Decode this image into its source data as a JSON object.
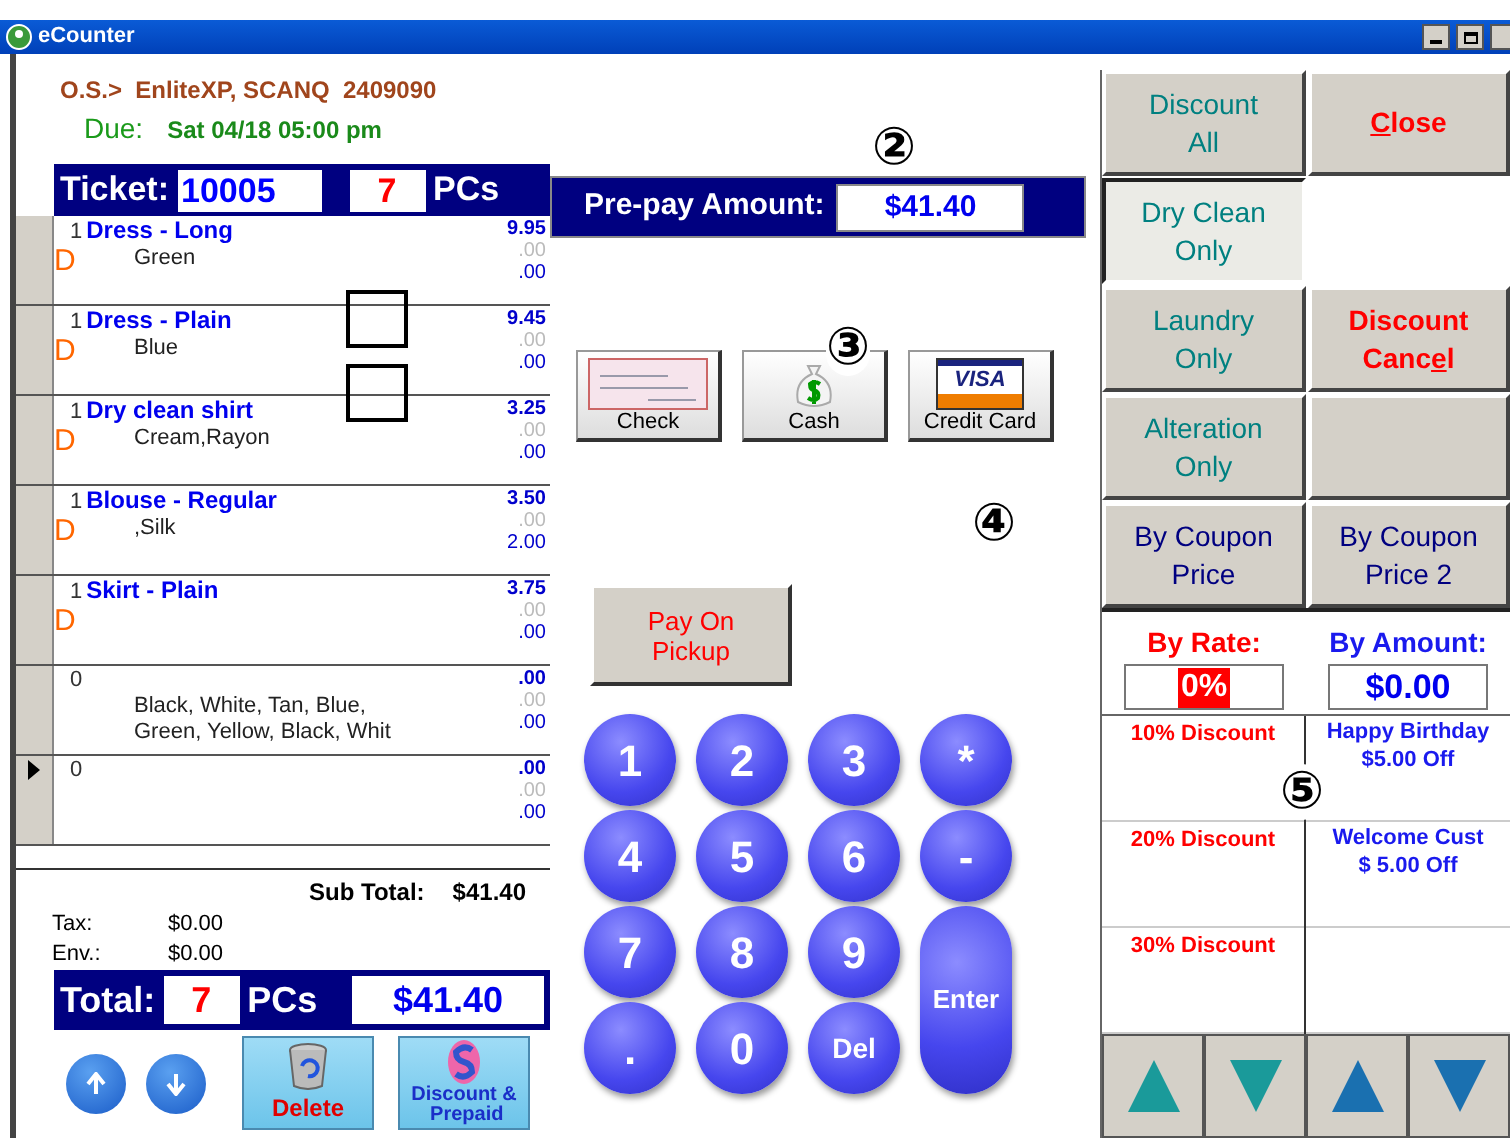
{
  "window": {
    "title": "eCounter"
  },
  "order": {
    "line": "O.S.>  EnliteXP, SCANQ  2409090",
    "due_label": "Due:",
    "due_value": "Sat 04/18 05:00 pm"
  },
  "ticket": {
    "label": "Ticket:",
    "number": "10005",
    "pieces": "7",
    "pieces_label": "PCs"
  },
  "items": [
    {
      "qty": "1",
      "name": "Dress - Long",
      "description": "Green",
      "price": "9.95",
      "line_2": ".00",
      "line_3": ".00",
      "mark": "D",
      "selected": false
    },
    {
      "qty": "1",
      "name": "Dress - Plain",
      "description": "Blue",
      "price": "9.45",
      "line_2": ".00",
      "line_3": ".00",
      "mark": "D",
      "selected": false
    },
    {
      "qty": "1",
      "name": "Dry clean shirt",
      "description": "Cream,Rayon",
      "price": "3.25",
      "line_2": ".00",
      "line_3": ".00",
      "mark": "D",
      "selected": false
    },
    {
      "qty": "1",
      "name": "Blouse - Regular",
      "description": ",Silk",
      "price": "3.50",
      "line_2": ".00",
      "line_3": "2.00",
      "mark": "D",
      "selected": false
    },
    {
      "qty": "1",
      "name": "Skirt - Plain",
      "price": "3.75",
      "line_2": ".00",
      "line_3": ".00",
      "mark": "D",
      "selected": false
    },
    {
      "qty": "0",
      "description": "Black, White, Tan, Blue,\nGreen, Yellow, Black, Whit",
      "price": ".00",
      "line_2": ".00",
      "line_3": ".00",
      "selected": false
    },
    {
      "qty": "0",
      "price": ".00",
      "line_2": ".00",
      "line_3": ".00",
      "selected": true
    }
  ],
  "summary": {
    "subtotal_label": "Sub Total:",
    "subtotal": "$41.40",
    "tax_label": "Tax:",
    "tax": "$0.00",
    "env_label": "Env.:",
    "env": "$0.00"
  },
  "total": {
    "label": "Total:",
    "pieces": "7",
    "pieces_label": "PCs",
    "amount": "$41.40"
  },
  "bottom_buttons": [
    {
      "kind": "up"
    },
    {
      "kind": "down"
    },
    {
      "kind": "delete",
      "label": "Delete"
    },
    {
      "kind": "discount",
      "label": "Discount &\n Prepaid"
    }
  ],
  "prepay": {
    "label": "Pre-pay Amount:",
    "amount": "$41.40"
  },
  "payment_methods": [
    {
      "kind": "check",
      "label": "Check"
    },
    {
      "kind": "cash",
      "label": "Cash"
    },
    {
      "kind": "card",
      "label": "Credit Card",
      "card_text": "VISA"
    }
  ],
  "pay_on_pickup": "Pay On\nPickup",
  "keypad": [
    {
      "label": "1",
      "kind": "round"
    },
    {
      "label": "2",
      "kind": "round"
    },
    {
      "label": "3",
      "kind": "round"
    },
    {
      "label": "*",
      "kind": "round"
    },
    {
      "label": "4",
      "kind": "round"
    },
    {
      "label": "5",
      "kind": "round"
    },
    {
      "label": "6",
      "kind": "round"
    },
    {
      "label": "-",
      "kind": "round"
    },
    {
      "label": "7",
      "kind": "round"
    },
    {
      "label": "8",
      "kind": "round"
    },
    {
      "label": "9",
      "kind": "round"
    },
    {
      "label": "Enter",
      "kind": "tall"
    },
    {
      "label": ".",
      "kind": "round"
    },
    {
      "label": "0",
      "kind": "round"
    },
    {
      "label": "Del",
      "kind": "round"
    }
  ],
  "discount_buttons": [
    {
      "kind": "button",
      "label": "Discount\nAll",
      "color": "#008080",
      "selected": false
    },
    {
      "kind": "button",
      "key": "C",
      "after": "lose",
      "color": "#ff0000",
      "selected": false
    },
    {
      "kind": "button",
      "label": "Dry Clean\nOnly",
      "color": "#008080",
      "selected": true
    },
    {
      "kind": "gap"
    },
    {
      "kind": "button",
      "label": "Laundry\nOnly",
      "color": "#008080",
      "selected": false
    },
    {
      "kind": "button",
      "before": "Discount\nCanc",
      "key": "e",
      "after": "l",
      "color": "#ff0000",
      "selected": false
    },
    {
      "kind": "button",
      "label": "Alteration\nOnly",
      "color": "#008080",
      "selected": false
    },
    {
      "kind": "blank"
    },
    {
      "kind": "button",
      "label": "By Coupon\nPrice",
      "color": "#000080",
      "selected": false
    },
    {
      "kind": "button",
      "label": "By Coupon\nPrice 2",
      "color": "#000080",
      "selected": false
    }
  ],
  "by_rate": {
    "label": "By Rate:",
    "value": "0%"
  },
  "by_amount": {
    "label": "By Amount:",
    "value": "$0.00"
  },
  "rate_discounts": [
    "10% Discount",
    "20% Discount",
    "30% Discount"
  ],
  "amount_discounts": [
    "Happy Birthday\n$5.00 Off",
    "Welcome Cust\n$ 5.00 Off"
  ],
  "annotations": [
    "②",
    "③",
    "④",
    "⑤"
  ]
}
